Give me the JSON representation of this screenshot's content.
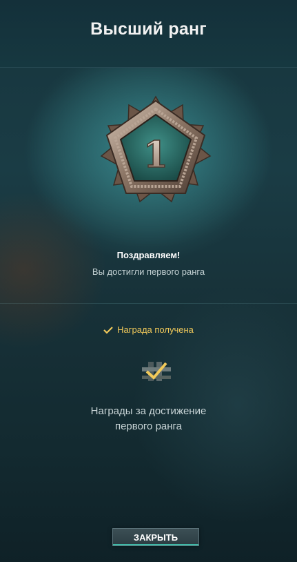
{
  "header": {
    "title": "Высший ранг"
  },
  "rank": {
    "number": "1",
    "congrats": "Поздравляем!",
    "subtitle": "Вы достигли первого ранга"
  },
  "reward": {
    "status": "Награда получена",
    "description_line1": "Награды за достижение",
    "description_line2": "первого ранга"
  },
  "actions": {
    "close_label": "ЗАКРЫТЬ"
  },
  "colors": {
    "accent_gold": "#f1c95a",
    "accent_teal": "#3fb9a7",
    "background": "#173138"
  },
  "icons": [
    "rank-badge-icon",
    "check-icon",
    "reward-item-icon"
  ]
}
